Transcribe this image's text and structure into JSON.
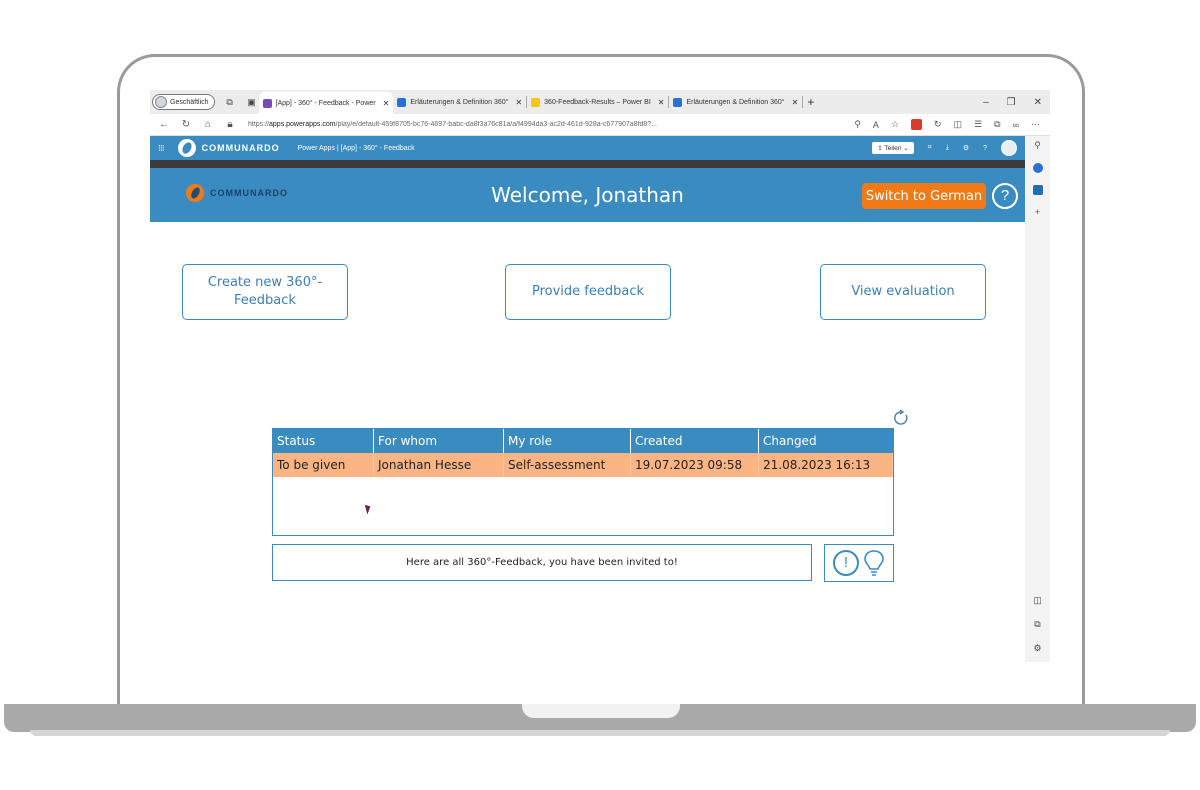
{
  "browser": {
    "profile_label": "Geschäftlich",
    "tabs": [
      {
        "title": "[App] - 360° - Feedback - Power",
        "active": true,
        "color": "#7a4bb3"
      },
      {
        "title": "Erläuterungen & Definition 360°",
        "active": false,
        "color": "#2b6fd1"
      },
      {
        "title": "360-Feedback-Results – Power BI",
        "active": false,
        "color": "#f2c811"
      },
      {
        "title": "Erläuterungen & Definition 360°",
        "active": false,
        "color": "#2b6fd1"
      }
    ],
    "url_prefix": "https://",
    "url_host": "apps.powerapps.com",
    "url_path": "/play/e/default-459f8705-bc76-4697-babc-da8f3a76c81a/a/f4994da3-ac2d-461d-928a-c677907a8fd8?..."
  },
  "powerapps": {
    "brand": "COMMUNARDO",
    "breadcrumb": "Power Apps | [App] - 360° - Feedback",
    "share_label": "Teilen"
  },
  "app": {
    "logo_text": "COMMUNARDO",
    "welcome": "Welcome, Jonathan",
    "switch_label": "Switch to German",
    "help_label": "?",
    "actions": {
      "create": "Create new 360°-Feedback",
      "provide": "Provide feedback",
      "view": "View evaluation"
    },
    "table": {
      "headers": [
        "Status",
        "For whom",
        "My role",
        "Created",
        "Changed"
      ],
      "rows": [
        [
          "To be given",
          "Jonathan Hesse",
          "Self-assessment",
          "19.07.2023 09:58",
          "21.08.2023 16:13"
        ]
      ]
    },
    "info_text": "Here are all 360°-Feedback, you have been invited to!",
    "info_icon_label": "!"
  },
  "colors": {
    "primary": "#3a8cc0",
    "accent": "#f07b16",
    "row_highlight": "#fbb484"
  }
}
